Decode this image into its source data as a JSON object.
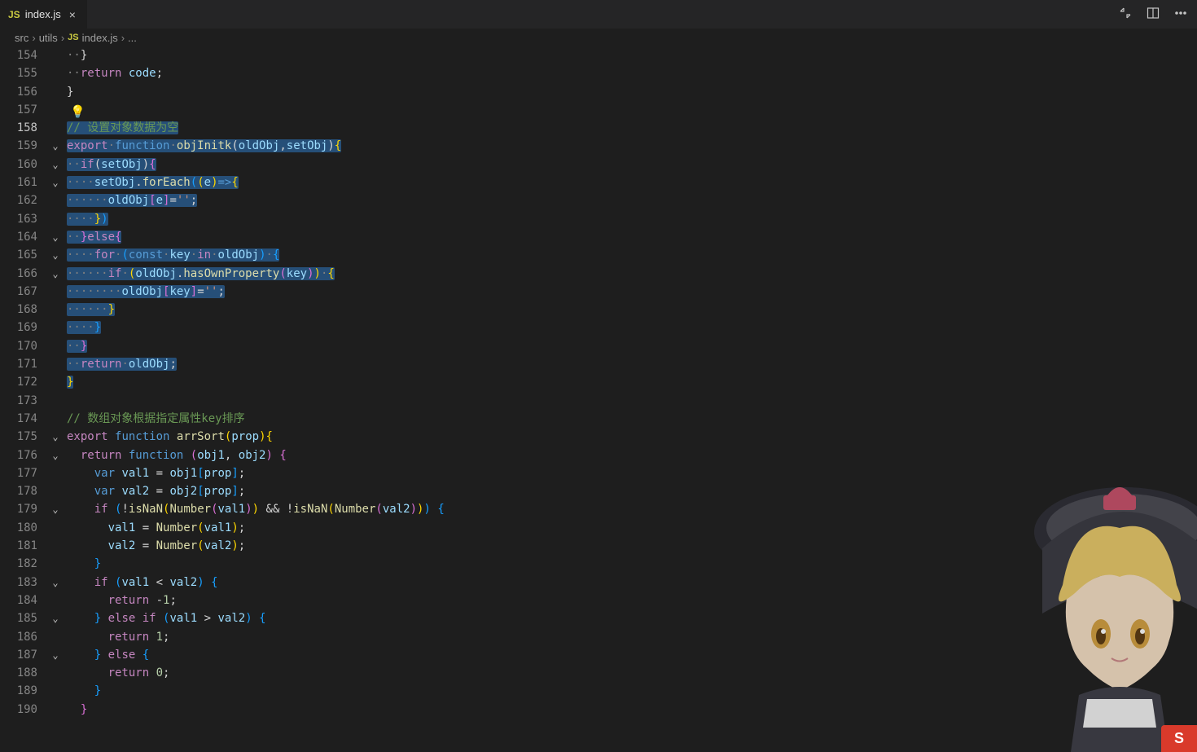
{
  "tabs": {
    "active": {
      "icon": "JS",
      "label": "index.js"
    }
  },
  "breadcrumbs": [
    "src",
    "utils",
    "index.js",
    "..."
  ],
  "lightbulb_line": 157,
  "lines": [
    {
      "n": 154,
      "fold": "",
      "sel": false,
      "tokens": [
        [
          "dot",
          "··"
        ],
        [
          "pn",
          "}"
        ]
      ]
    },
    {
      "n": 155,
      "fold": "",
      "sel": false,
      "tokens": [
        [
          "dot",
          "··"
        ],
        [
          "kw",
          "return"
        ],
        [
          "pn",
          " "
        ],
        [
          "id",
          "code"
        ],
        [
          "pn",
          ";"
        ]
      ]
    },
    {
      "n": 156,
      "fold": "",
      "sel": false,
      "tokens": [
        [
          "pn",
          "}"
        ]
      ]
    },
    {
      "n": 157,
      "fold": "",
      "sel": false,
      "tokens": []
    },
    {
      "n": 158,
      "fold": "",
      "sel": true,
      "active": true,
      "tokens": [
        [
          "cm",
          "// 设置对象数据为空"
        ]
      ]
    },
    {
      "n": 159,
      "fold": "v",
      "sel": true,
      "tokens": [
        [
          "kw",
          "export"
        ],
        [
          "dot",
          "·"
        ],
        [
          "type",
          "function"
        ],
        [
          "dot",
          "·"
        ],
        [
          "fn",
          "objInitk"
        ],
        [
          "pn",
          "("
        ],
        [
          "id",
          "oldObj"
        ],
        [
          "pn",
          ","
        ],
        [
          "id",
          "setObj"
        ],
        [
          "pn",
          ")"
        ],
        [
          "br",
          "{"
        ]
      ]
    },
    {
      "n": 160,
      "fold": "v",
      "sel": true,
      "tokens": [
        [
          "dot",
          "··"
        ],
        [
          "kw",
          "if"
        ],
        [
          "pn",
          "("
        ],
        [
          "id",
          "setObj"
        ],
        [
          "pn",
          ")"
        ],
        [
          "br2",
          "{"
        ]
      ]
    },
    {
      "n": 161,
      "fold": "v",
      "sel": true,
      "tokens": [
        [
          "dot",
          "····"
        ],
        [
          "id",
          "setObj"
        ],
        [
          "pn",
          "."
        ],
        [
          "fn",
          "forEach"
        ],
        [
          "br3",
          "("
        ],
        [
          "br",
          "("
        ],
        [
          "id",
          "e"
        ],
        [
          "br",
          ")"
        ],
        [
          "type",
          "=>"
        ],
        [
          "br",
          "{"
        ]
      ]
    },
    {
      "n": 162,
      "fold": "",
      "sel": true,
      "tokens": [
        [
          "dot",
          "······"
        ],
        [
          "id",
          "oldObj"
        ],
        [
          "br2",
          "["
        ],
        [
          "id",
          "e"
        ],
        [
          "br2",
          "]"
        ],
        [
          "pn",
          "="
        ],
        [
          "str",
          "''"
        ],
        [
          "pn",
          ";"
        ]
      ]
    },
    {
      "n": 163,
      "fold": "",
      "sel": true,
      "tokens": [
        [
          "dot",
          "····"
        ],
        [
          "br",
          "}"
        ],
        [
          "br3",
          ")"
        ]
      ]
    },
    {
      "n": 164,
      "fold": "v",
      "sel": true,
      "tokens": [
        [
          "dot",
          "··"
        ],
        [
          "br2",
          "}"
        ],
        [
          "kw",
          "else"
        ],
        [
          "br2",
          "{"
        ]
      ]
    },
    {
      "n": 165,
      "fold": "v",
      "sel": true,
      "tokens": [
        [
          "dot",
          "····"
        ],
        [
          "kw",
          "for"
        ],
        [
          "dot",
          "·"
        ],
        [
          "br3",
          "("
        ],
        [
          "type",
          "const"
        ],
        [
          "dot",
          "·"
        ],
        [
          "id",
          "key"
        ],
        [
          "dot",
          "·"
        ],
        [
          "kw",
          "in"
        ],
        [
          "dot",
          "·"
        ],
        [
          "id",
          "oldObj"
        ],
        [
          "br3",
          ")"
        ],
        [
          "dot",
          "·"
        ],
        [
          "br3",
          "{"
        ]
      ]
    },
    {
      "n": 166,
      "fold": "v",
      "sel": true,
      "tokens": [
        [
          "dot",
          "······"
        ],
        [
          "kw",
          "if"
        ],
        [
          "dot",
          "·"
        ],
        [
          "br",
          "("
        ],
        [
          "id",
          "oldObj"
        ],
        [
          "pn",
          "."
        ],
        [
          "fn",
          "hasOwnProperty"
        ],
        [
          "br2",
          "("
        ],
        [
          "id",
          "key"
        ],
        [
          "br2",
          ")"
        ],
        [
          "br",
          ")"
        ],
        [
          "dot",
          "·"
        ],
        [
          "br",
          "{"
        ]
      ]
    },
    {
      "n": 167,
      "fold": "",
      "sel": true,
      "tokens": [
        [
          "dot",
          "········"
        ],
        [
          "id",
          "oldObj"
        ],
        [
          "br2",
          "["
        ],
        [
          "id",
          "key"
        ],
        [
          "br2",
          "]"
        ],
        [
          "pn",
          "="
        ],
        [
          "str",
          "''"
        ],
        [
          "pn",
          ";"
        ]
      ]
    },
    {
      "n": 168,
      "fold": "",
      "sel": true,
      "tokens": [
        [
          "dot",
          "······"
        ],
        [
          "br",
          "}"
        ]
      ]
    },
    {
      "n": 169,
      "fold": "",
      "sel": true,
      "tokens": [
        [
          "dot",
          "····"
        ],
        [
          "br3",
          "}"
        ]
      ]
    },
    {
      "n": 170,
      "fold": "",
      "sel": true,
      "tokens": [
        [
          "dot",
          "··"
        ],
        [
          "br2",
          "}"
        ]
      ]
    },
    {
      "n": 171,
      "fold": "",
      "sel": true,
      "tokens": [
        [
          "dot",
          "··"
        ],
        [
          "kw",
          "return"
        ],
        [
          "dot",
          "·"
        ],
        [
          "id",
          "oldObj"
        ],
        [
          "pn",
          ";"
        ]
      ]
    },
    {
      "n": 172,
      "fold": "",
      "sel": true,
      "tokens": [
        [
          "br",
          "}"
        ]
      ]
    },
    {
      "n": 173,
      "fold": "",
      "sel": false,
      "tokens": []
    },
    {
      "n": 174,
      "fold": "",
      "sel": false,
      "tokens": [
        [
          "cm",
          "// 数组对象根据指定属性key排序"
        ]
      ]
    },
    {
      "n": 175,
      "fold": "v",
      "sel": false,
      "tokens": [
        [
          "kw",
          "export"
        ],
        [
          "pn",
          " "
        ],
        [
          "type",
          "function"
        ],
        [
          "pn",
          " "
        ],
        [
          "fn",
          "arrSort"
        ],
        [
          "br",
          "("
        ],
        [
          "id",
          "prop"
        ],
        [
          "br",
          ")"
        ],
        [
          "br",
          "{"
        ]
      ]
    },
    {
      "n": 176,
      "fold": "v",
      "sel": false,
      "tokens": [
        [
          "dot",
          "  "
        ],
        [
          "kw",
          "return"
        ],
        [
          "pn",
          " "
        ],
        [
          "type",
          "function"
        ],
        [
          "pn",
          " "
        ],
        [
          "br2",
          "("
        ],
        [
          "id",
          "obj1"
        ],
        [
          "pn",
          ", "
        ],
        [
          "id",
          "obj2"
        ],
        [
          "br2",
          ")"
        ],
        [
          "pn",
          " "
        ],
        [
          "br2",
          "{"
        ]
      ]
    },
    {
      "n": 177,
      "fold": "",
      "sel": false,
      "tokens": [
        [
          "dot",
          "    "
        ],
        [
          "type",
          "var"
        ],
        [
          "pn",
          " "
        ],
        [
          "id",
          "val1"
        ],
        [
          "pn",
          " = "
        ],
        [
          "id",
          "obj1"
        ],
        [
          "br3",
          "["
        ],
        [
          "id",
          "prop"
        ],
        [
          "br3",
          "]"
        ],
        [
          "pn",
          ";"
        ]
      ]
    },
    {
      "n": 178,
      "fold": "",
      "sel": false,
      "tokens": [
        [
          "dot",
          "    "
        ],
        [
          "type",
          "var"
        ],
        [
          "pn",
          " "
        ],
        [
          "id",
          "val2"
        ],
        [
          "pn",
          " = "
        ],
        [
          "id",
          "obj2"
        ],
        [
          "br3",
          "["
        ],
        [
          "id",
          "prop"
        ],
        [
          "br3",
          "]"
        ],
        [
          "pn",
          ";"
        ]
      ]
    },
    {
      "n": 179,
      "fold": "v",
      "sel": false,
      "tokens": [
        [
          "dot",
          "    "
        ],
        [
          "kw",
          "if"
        ],
        [
          "pn",
          " "
        ],
        [
          "br3",
          "("
        ],
        [
          "pn",
          "!"
        ],
        [
          "fn",
          "isNaN"
        ],
        [
          "br",
          "("
        ],
        [
          "fn",
          "Number"
        ],
        [
          "br2",
          "("
        ],
        [
          "id",
          "val1"
        ],
        [
          "br2",
          ")"
        ],
        [
          "br",
          ")"
        ],
        [
          "pn",
          " && !"
        ],
        [
          "fn",
          "isNaN"
        ],
        [
          "br",
          "("
        ],
        [
          "fn",
          "Number"
        ],
        [
          "br2",
          "("
        ],
        [
          "id",
          "val2"
        ],
        [
          "br2",
          ")"
        ],
        [
          "br",
          ")"
        ],
        [
          "br3",
          ")"
        ],
        [
          "pn",
          " "
        ],
        [
          "br3",
          "{"
        ]
      ]
    },
    {
      "n": 180,
      "fold": "",
      "sel": false,
      "tokens": [
        [
          "dot",
          "      "
        ],
        [
          "id",
          "val1"
        ],
        [
          "pn",
          " = "
        ],
        [
          "fn",
          "Number"
        ],
        [
          "br",
          "("
        ],
        [
          "id",
          "val1"
        ],
        [
          "br",
          ")"
        ],
        [
          "pn",
          ";"
        ]
      ]
    },
    {
      "n": 181,
      "fold": "",
      "sel": false,
      "tokens": [
        [
          "dot",
          "      "
        ],
        [
          "id",
          "val2"
        ],
        [
          "pn",
          " = "
        ],
        [
          "fn",
          "Number"
        ],
        [
          "br",
          "("
        ],
        [
          "id",
          "val2"
        ],
        [
          "br",
          ")"
        ],
        [
          "pn",
          ";"
        ]
      ]
    },
    {
      "n": 182,
      "fold": "",
      "sel": false,
      "tokens": [
        [
          "dot",
          "    "
        ],
        [
          "br3",
          "}"
        ]
      ]
    },
    {
      "n": 183,
      "fold": "v",
      "sel": false,
      "tokens": [
        [
          "dot",
          "    "
        ],
        [
          "kw",
          "if"
        ],
        [
          "pn",
          " "
        ],
        [
          "br3",
          "("
        ],
        [
          "id",
          "val1"
        ],
        [
          "pn",
          " < "
        ],
        [
          "id",
          "val2"
        ],
        [
          "br3",
          ")"
        ],
        [
          "pn",
          " "
        ],
        [
          "br3",
          "{"
        ]
      ]
    },
    {
      "n": 184,
      "fold": "",
      "sel": false,
      "tokens": [
        [
          "dot",
          "      "
        ],
        [
          "kw",
          "return"
        ],
        [
          "pn",
          " -"
        ],
        [
          "num",
          "1"
        ],
        [
          "pn",
          ";"
        ]
      ]
    },
    {
      "n": 185,
      "fold": "v",
      "sel": false,
      "tokens": [
        [
          "dot",
          "    "
        ],
        [
          "br3",
          "}"
        ],
        [
          "pn",
          " "
        ],
        [
          "kw",
          "else"
        ],
        [
          "pn",
          " "
        ],
        [
          "kw",
          "if"
        ],
        [
          "pn",
          " "
        ],
        [
          "br3",
          "("
        ],
        [
          "id",
          "val1"
        ],
        [
          "pn",
          " > "
        ],
        [
          "id",
          "val2"
        ],
        [
          "br3",
          ")"
        ],
        [
          "pn",
          " "
        ],
        [
          "br3",
          "{"
        ]
      ]
    },
    {
      "n": 186,
      "fold": "",
      "sel": false,
      "tokens": [
        [
          "dot",
          "      "
        ],
        [
          "kw",
          "return"
        ],
        [
          "pn",
          " "
        ],
        [
          "num",
          "1"
        ],
        [
          "pn",
          ";"
        ]
      ]
    },
    {
      "n": 187,
      "fold": "v",
      "sel": false,
      "tokens": [
        [
          "dot",
          "    "
        ],
        [
          "br3",
          "}"
        ],
        [
          "pn",
          " "
        ],
        [
          "kw",
          "else"
        ],
        [
          "pn",
          " "
        ],
        [
          "br3",
          "{"
        ]
      ]
    },
    {
      "n": 188,
      "fold": "",
      "sel": false,
      "tokens": [
        [
          "dot",
          "      "
        ],
        [
          "kw",
          "return"
        ],
        [
          "pn",
          " "
        ],
        [
          "num",
          "0"
        ],
        [
          "pn",
          ";"
        ]
      ]
    },
    {
      "n": 189,
      "fold": "",
      "sel": false,
      "tokens": [
        [
          "dot",
          "    "
        ],
        [
          "br3",
          "}"
        ]
      ]
    },
    {
      "n": 190,
      "fold": "",
      "sel": false,
      "tokens": [
        [
          "dot",
          "  "
        ],
        [
          "br2",
          "}"
        ]
      ]
    }
  ],
  "ime_badge": "S"
}
